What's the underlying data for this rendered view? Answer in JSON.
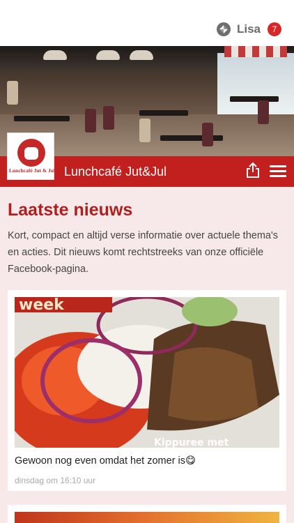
{
  "user": {
    "name": "Lisa",
    "notifications": "7"
  },
  "brand": {
    "title": "Lunchcafé Jut&Jul",
    "logo_text": "Lunchcafé Jut & Jul"
  },
  "news": {
    "heading": "Laatste nieuws",
    "intro": "Kort, compact en altijd verse informatie over actuele thema's en acties. Dit nieuws komt rechtstreeks van onze officiële Facebook-pagina.",
    "posts": [
      {
        "caption": "Gewoon nog even omdat het zomer is😋",
        "time": "dinsdag om 16:10 uur",
        "photo_text_top": "week",
        "photo_text_bottom": "Kippuree met"
      }
    ]
  },
  "colors": {
    "brand_red": "#c21f1f",
    "heading_red": "#b01f1f",
    "background": "#f7e9e9",
    "badge_red": "#d62828"
  },
  "icons": [
    "app-logo-icon",
    "share-icon",
    "hamburger-menu-icon"
  ]
}
